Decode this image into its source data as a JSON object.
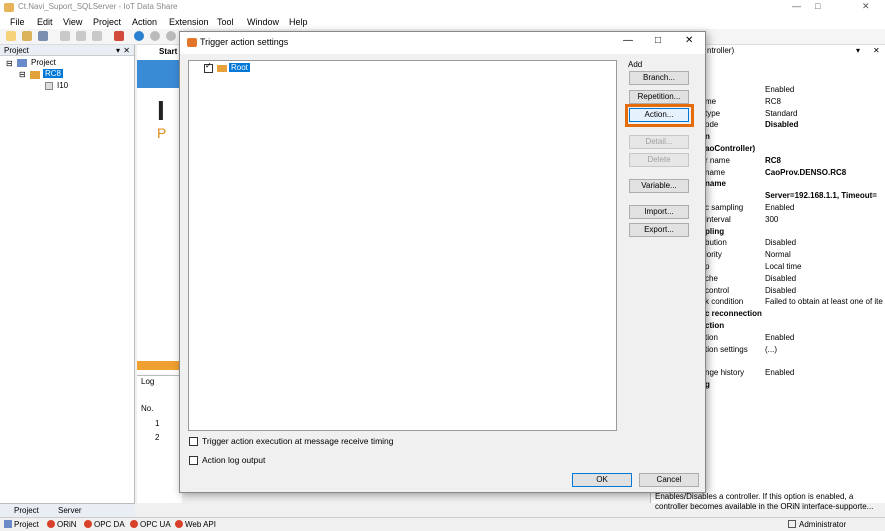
{
  "window": {
    "title": "Ct.Navi_Suport_SQLServer - IoT Data Share"
  },
  "menu": [
    "File",
    "Edit",
    "View",
    "Project",
    "Action",
    "Extension",
    "Tool",
    "Window",
    "Help"
  ],
  "project_panel": {
    "title": "Project",
    "root": "Project",
    "controller": "RC8",
    "child": "I10",
    "tabs": [
      "Project",
      "Server"
    ]
  },
  "start_tab": {
    "label": "Start"
  },
  "log_panel": {
    "title": "Log",
    "col_no": "No.",
    "rows": [
      "1",
      "2"
    ]
  },
  "properties": {
    "title": "ntroller)",
    "rows": [
      {
        "k": "",
        "v": "Enabled"
      },
      {
        "k": "me",
        "v": "RC8"
      },
      {
        "k": "type",
        "v": "Standard"
      },
      {
        "k": "ode",
        "v": "Disabled"
      },
      {
        "k": "n",
        "v": ""
      },
      {
        "k": "aoController)",
        "v": ""
      },
      {
        "k": "r name",
        "v": "RC8"
      },
      {
        "k": "name",
        "v": "CaoProv.DENSO.RC8"
      },
      {
        "k": "name",
        "v": ""
      },
      {
        "k": "",
        "v": "Server=192.168.1.1, Timeout="
      },
      {
        "k": "c sampling",
        "v": "Enabled"
      },
      {
        "k": "interval",
        "v": "300"
      },
      {
        "k": "pling",
        "v": ""
      },
      {
        "k": "bution",
        "v": "Disabled"
      },
      {
        "k": "iority",
        "v": "Normal"
      },
      {
        "k": "p",
        "v": "Local time"
      },
      {
        "k": "che",
        "v": "Disabled"
      },
      {
        "k": "control",
        "v": "Disabled"
      },
      {
        "k": "k condition",
        "v": "Failed to obtain at least one of ite"
      },
      {
        "k": "c reconnection",
        "v": ""
      },
      {
        "k": "ction",
        "v": ""
      },
      {
        "k": "tion",
        "v": "Enabled"
      },
      {
        "k": "tion settings",
        "v": "(...)"
      },
      {
        "k": "",
        "v": ""
      },
      {
        "k": "nge history",
        "v": "Enabled"
      },
      {
        "k": "g",
        "v": ""
      }
    ],
    "description": "Enables/Disables a controller. If this option is enabled, a controller becomes available in the ORiN interface-supporte..."
  },
  "dialog": {
    "title": "Trigger action settings",
    "tree_root": "Root",
    "add_label": "Add",
    "buttons": {
      "branch": "Branch...",
      "repetition": "Repetition...",
      "action": "Action...",
      "detail": "Detail...",
      "delete": "Delete",
      "variable": "Variable...",
      "import": "Import...",
      "export": "Export..."
    },
    "check_msg": "Trigger action execution at message receive timing",
    "check_log": "Action log output",
    "ok": "OK",
    "cancel": "Cancel"
  },
  "statusbar": {
    "items": [
      "Project",
      "ORiN",
      "OPC DA",
      "OPC UA",
      "Web API"
    ],
    "user": "Administrator"
  },
  "colors": {
    "highlight": "#e46c0a",
    "selection": "#0078d7"
  }
}
